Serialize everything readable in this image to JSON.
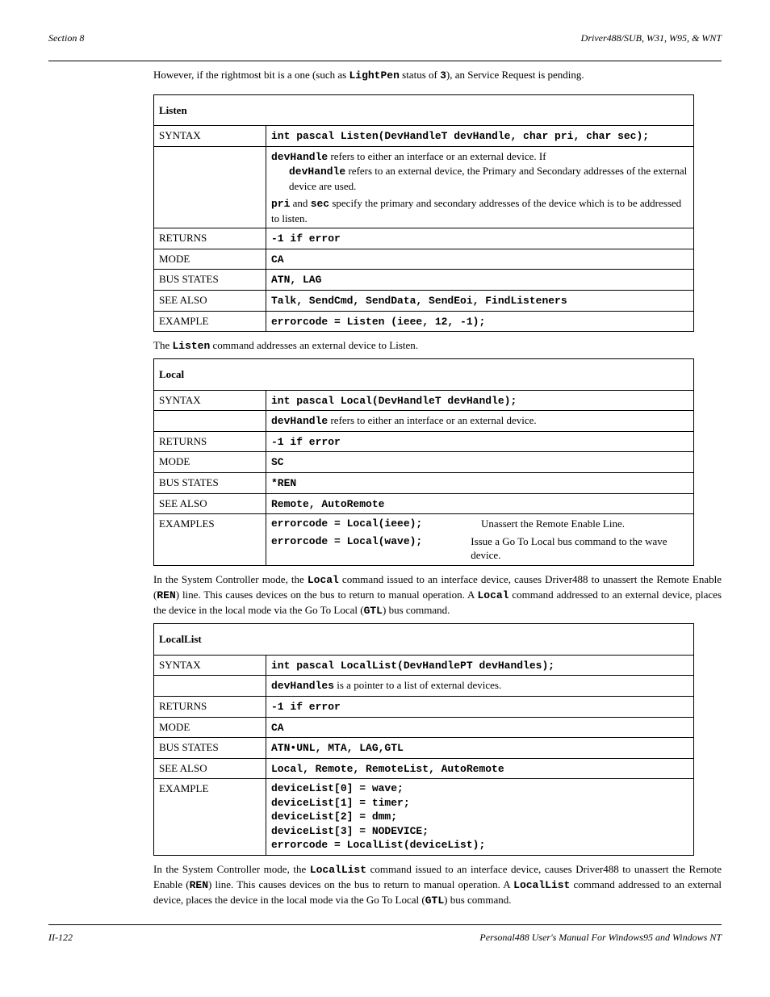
{
  "header": {
    "left": "Section 8",
    "right": "Driver488/SUB, W31, W95, & WNT"
  },
  "intro": {
    "text_before": "However, if the rightmost bit is a one (such as ",
    "code1": "LightPen",
    "text_mid": " status of ",
    "code2": "3",
    "text_after": "), an Service Request is pending."
  },
  "listen": {
    "title": "Listen",
    "rows": {
      "syntax_label": "SYNTAX",
      "syntax": "int pascal Listen(DevHandleT devHandle, char pri, char sec);",
      "devHandle_label": "devHandle",
      "devHandle_text": " refers to either an interface or an external device. If ",
      "devHandle_code2": "devHandle",
      "devHandle_text2": " refers to an external device, the Primary and Secondary addresses of the external device are used.",
      "prisec_pri": "pri",
      "prisec_and": " and ",
      "prisec_sec": "sec",
      "prisec_text": " specify the primary and secondary addresses of the device which is to be addressed to listen.",
      "returns_label": "RETURNS",
      "returns": "-1 if error",
      "mode_label": "MODE",
      "mode": "CA",
      "busstates_label": "BUS STATES",
      "busstates": "ATN, LAG",
      "seealso_label": "SEE ALSO",
      "seealso": "Talk, SendCmd, SendData, SendEoi, FindListeners",
      "example_label": "EXAMPLE",
      "example": "errorcode = Listen (ieee, 12, -1);"
    },
    "after": {
      "text_before": "The ",
      "code": "Listen",
      "text_after": " command addresses an external device to Listen."
    }
  },
  "local": {
    "title": "Local",
    "rows": {
      "syntax_label": "SYNTAX",
      "syntax": "int pascal Local(DevHandleT devHandle);",
      "devHandle_label": "devHandle",
      "devHandle_text": " refers to either an interface or an external device.",
      "returns_label": "RETURNS",
      "returns": "-1 if error",
      "mode_label": "MODE",
      "mode": "SC",
      "busstates_label": "BUS STATES",
      "busstates": "*REN",
      "seealso_label": "SEE ALSO",
      "seealso": "Remote, AutoRemote",
      "examples_label": "EXAMPLES",
      "ex1_code": "errorcode = Local(ieee);",
      "ex1_comment": "Unassert the Remote Enable Line.",
      "ex2_code": "errorcode = Local(wave);",
      "ex2_comment": "Issue a Go To Local bus command to the wave device."
    },
    "after": {
      "p1_a": "In the System Controller mode, the ",
      "p1_code1": "Local",
      "p1_b": " command issued to an interface device, causes Driver488 to unassert the Remote Enable (",
      "p1_code2": "REN",
      "p1_c": ") line. This causes devices on the bus to return to manual operation. A ",
      "p1_code3": "Local",
      "p1_d": " command addressed to an external device, places the device in the local mode via the Go To Local (",
      "p1_code4": "GTL",
      "p1_e": ") bus command."
    }
  },
  "localList": {
    "title": "LocalList",
    "rows": {
      "syntax_label": "SYNTAX",
      "syntax": "int pascal LocalList(DevHandlePT devHandles);",
      "devHandles_label": "devHandles",
      "devHandles_text": " is a pointer to a list of external devices.",
      "returns_label": "RETURNS",
      "returns": "-1 if error",
      "mode_label": "MODE",
      "mode": "CA",
      "busstates_label": "BUS STATES",
      "busstates": "ATN•UNL, MTA, LAG,GTL",
      "seealso_label": "SEE ALSO",
      "seealso": "Local, Remote, RemoteList, AutoRemote",
      "example_label": "EXAMPLE",
      "ex_l1": "deviceList[0] = wave;",
      "ex_l2": "deviceList[1] = timer;",
      "ex_l3": "deviceList[2] = dmm;",
      "ex_l4": "deviceList[3] = NODEVICE;",
      "ex_l5": "errorcode = LocalList(deviceList);"
    },
    "after": {
      "p1_a": "In the System Controller mode, the ",
      "p1_code1": "LocalList",
      "p1_b": " command issued to an interface device, causes Driver488 to unassert the Remote Enable (",
      "p1_code2": "REN",
      "p1_c": ") line. This causes devices on the bus to return to manual operation. A ",
      "p1_code3": "LocalList",
      "p1_d": " command addressed to an external device, places the device in the local mode via the Go To Local (",
      "p1_code4": "GTL",
      "p1_e": ") bus command."
    }
  },
  "footer": {
    "left": "II-122",
    "right": "Personal488 User's Manual For Windows95 and Windows NT"
  }
}
